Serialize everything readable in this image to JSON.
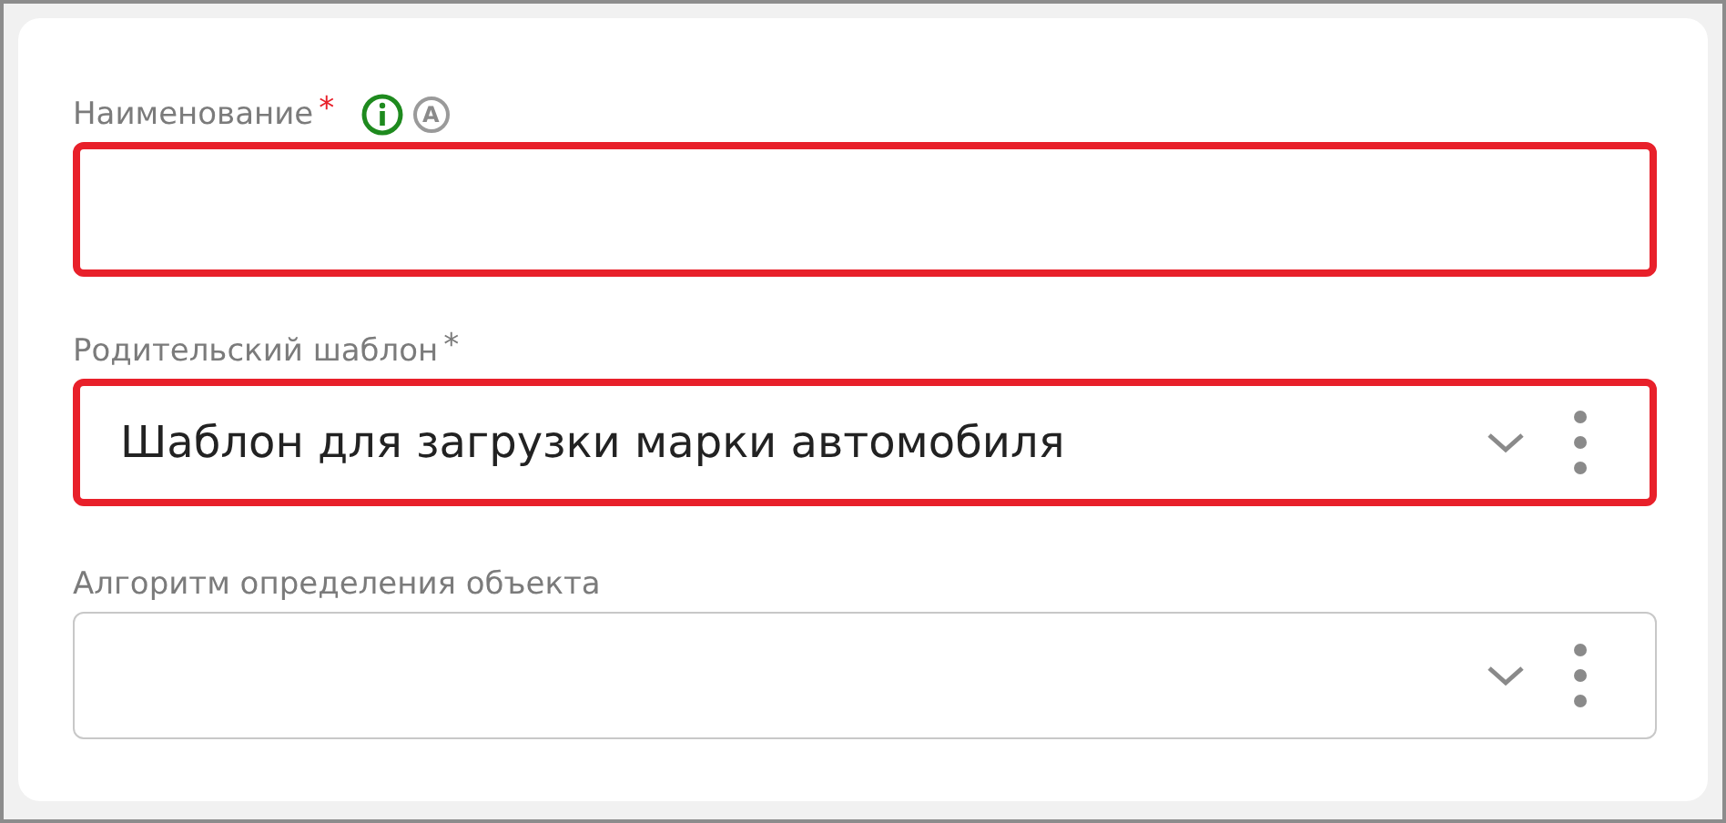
{
  "fields": [
    {
      "kind": "text",
      "label": "Наименование",
      "required_mark": {
        "text": "*",
        "highlighted": true
      },
      "error": true,
      "icons": [
        {
          "kind": "info"
        },
        {
          "kind": "letter",
          "text": "A"
        }
      ]
    },
    {
      "kind": "select",
      "label": "Родительский шаблон",
      "required_mark": {
        "text": "*",
        "highlighted": false
      },
      "error": true,
      "value": "Шаблон для загрузки марки автомобиля"
    },
    {
      "kind": "select",
      "label": "Алгоритм определения объекта",
      "error": false
    }
  ]
}
